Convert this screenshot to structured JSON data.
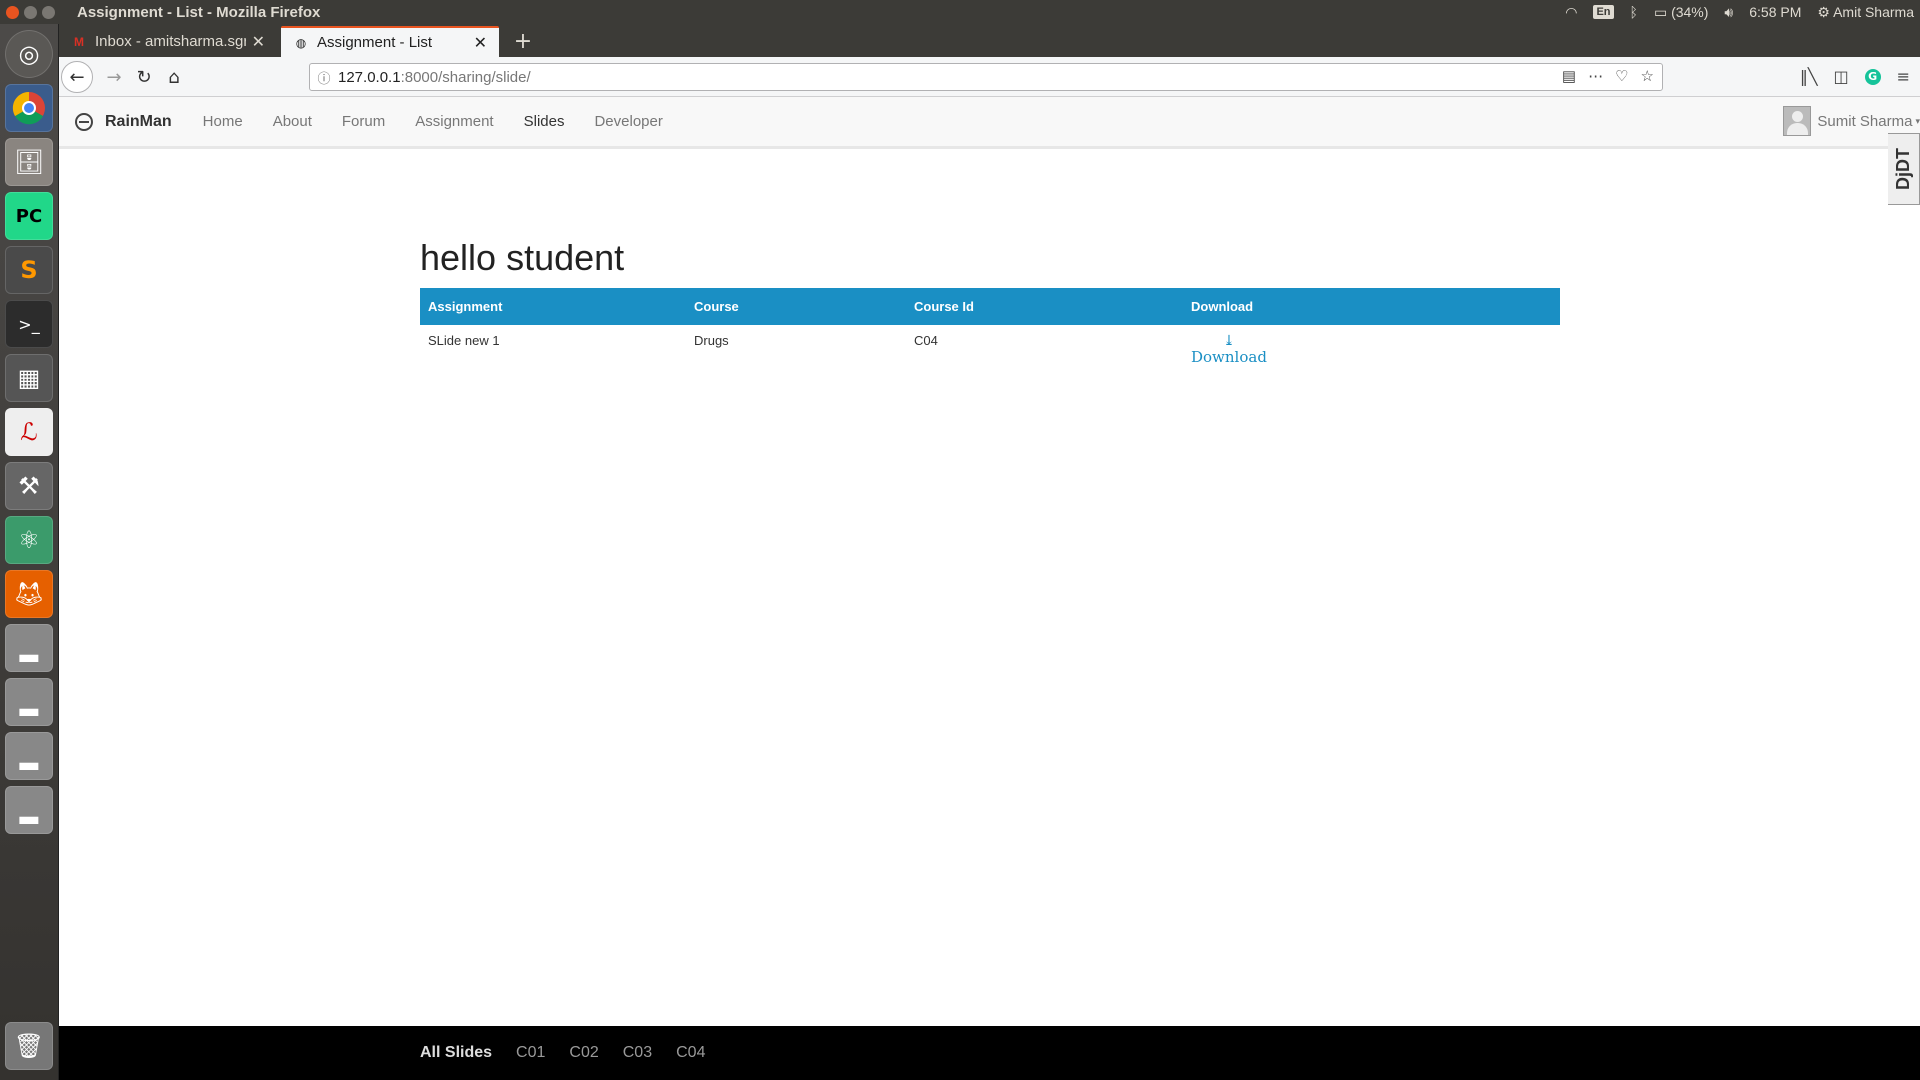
{
  "system": {
    "window_title": "Assignment - List - Mozilla Firefox",
    "keyboard_layout": "En",
    "battery": "(34%)",
    "clock": "6:58 PM",
    "user": "Amit Sharma"
  },
  "launcher": {
    "items": [
      "ubuntu-dash-icon",
      "chrome-icon",
      "files-icon",
      "pycharm-icon",
      "sublime-icon",
      "terminal-icon",
      "workspaces-icon",
      "document-viewer-icon",
      "settings-icon",
      "atom-icon",
      "firefox-icon",
      "drive-icon",
      "drive-icon",
      "drive-icon",
      "drive-icon",
      "trash-icon"
    ],
    "pycharm_label": "PC",
    "sublime_label": "S"
  },
  "browser": {
    "tabs": [
      {
        "label": "Inbox - amitsharma.sgrs",
        "favicon": "gmail-icon"
      },
      {
        "label": "Assignment - List",
        "favicon": "globe-icon"
      }
    ],
    "url_host": "127.0.0.1",
    "url_path": ":8000/sharing/slide/"
  },
  "site": {
    "brand": "RainMan",
    "nav": [
      "Home",
      "About",
      "Forum",
      "Assignment",
      "Slides",
      "Developer"
    ],
    "active_nav": "Slides",
    "user_name": "Sumit Sharma",
    "ddt_label": "DjDT"
  },
  "main": {
    "heading": "hello student",
    "table": {
      "headers": [
        "Assignment",
        "Course",
        "Course Id",
        "Download"
      ],
      "rows": [
        {
          "assignment": "SLide new 1",
          "course": "Drugs",
          "course_id": "C04",
          "download": "Download"
        }
      ]
    }
  },
  "footer": {
    "items": [
      "All Slides",
      "C01",
      "C02",
      "C03",
      "C04"
    ]
  },
  "colors": {
    "table_header": "#1a8fc4",
    "ubuntu_orange": "#e95420",
    "footer_bg": "#000000"
  }
}
